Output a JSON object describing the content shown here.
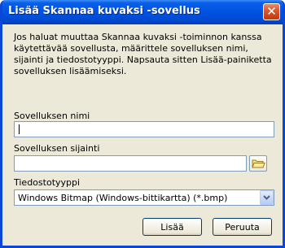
{
  "window": {
    "title": "Lisää Skannaa kuvaksi -sovellus"
  },
  "description": "Jos haluat muuttaa Skannaa kuvaksi -toiminnon kanssa käytettävää sovellusta, määrittele sovelluksen nimi, sijainti ja tiedostotyyppi. Napsauta sitten Lisää-painiketta sovelluksen lisäämiseksi.",
  "form": {
    "name_label": "Sovelluksen nimi",
    "name_value": "",
    "location_label": "Sovelluksen sijainti",
    "location_value": "",
    "filetype_label": "Tiedostotyyppi",
    "filetype_selected": "Windows Bitmap (Windows-bittikartta) (*.bmp)"
  },
  "buttons": {
    "add": "Lisää",
    "cancel": "Peruuta"
  },
  "icons": {
    "close": "close-icon",
    "browse": "folder-icon",
    "dropdown": "chevron-down-icon"
  },
  "colors": {
    "titlebar": "#0054e3",
    "frame": "#0a46d8",
    "dialog_bg": "#ece9d8",
    "close_button": "#d9542c"
  }
}
